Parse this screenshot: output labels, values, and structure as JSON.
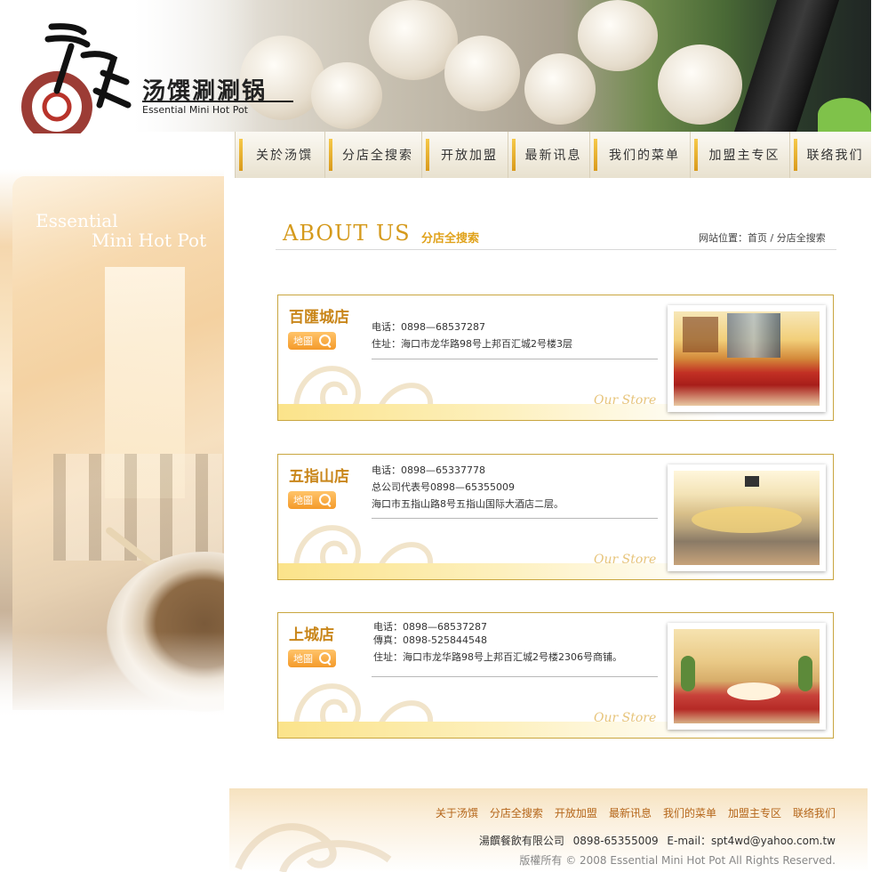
{
  "brand": {
    "name_cn": "汤馔涮涮锅",
    "name_en": "Essential Mini Hot Pot"
  },
  "nav": {
    "items": [
      {
        "label": "关於汤馔"
      },
      {
        "label": "分店全搜索"
      },
      {
        "label": "开放加盟"
      },
      {
        "label": "最新讯息"
      },
      {
        "label": "我们的菜单"
      },
      {
        "label": "加盟主专区"
      },
      {
        "label": "联络我们"
      }
    ]
  },
  "side": {
    "line1": "Essential",
    "line2": "Mini Hot Pot"
  },
  "page": {
    "title_en": "ABOUT US",
    "title_cn": "分店全搜索",
    "breadcrumb": "网站位置：首页 / 分店全搜索"
  },
  "stores": [
    {
      "name": "百匯城店",
      "map_label": "地圖",
      "lines": [
        "电话：0898—68537287",
        "住址：海口市龙华路98号上邦百汇城2号楼3层"
      ],
      "watermark": "Our Store",
      "photo": "restaurant-interior-red-booth"
    },
    {
      "name": "五指山店",
      "map_label": "地圖",
      "lines": [
        "电话：0898—65337778",
        "总公司代表号0898—65355009",
        "海口市五指山路8号五指山国际大酒店二层。"
      ],
      "watermark": "Our Store",
      "photo": "restaurant-interior-round-bar"
    },
    {
      "name": "上城店",
      "map_label": "地圖",
      "lines": [
        "电话：0898—68537287",
        "傳真：0898-525844548",
        "住址：海口市龙华路98号上邦百汇城2号楼2306号商铺。"
      ],
      "watermark": "Our Store",
      "photo": "private-dining-room-red-chairs"
    }
  ],
  "footer": {
    "links": [
      {
        "label": "关于汤馔"
      },
      {
        "label": "分店全搜索"
      },
      {
        "label": "开放加盟"
      },
      {
        "label": "最新讯息"
      },
      {
        "label": "我们的菜单"
      },
      {
        "label": "加盟主专区"
      },
      {
        "label": "联络我们"
      }
    ],
    "company": "湯饌餐飲有限公司  0898-65355009  E-mail：spt4wd@yahoo.com.tw",
    "copyright": "版權所有 © 2008 Essential Mini Hot Pot  All Rights Reserved."
  },
  "colors": {
    "accent": "#d59a1c",
    "border": "#c9a640",
    "link": "#b5661a"
  }
}
